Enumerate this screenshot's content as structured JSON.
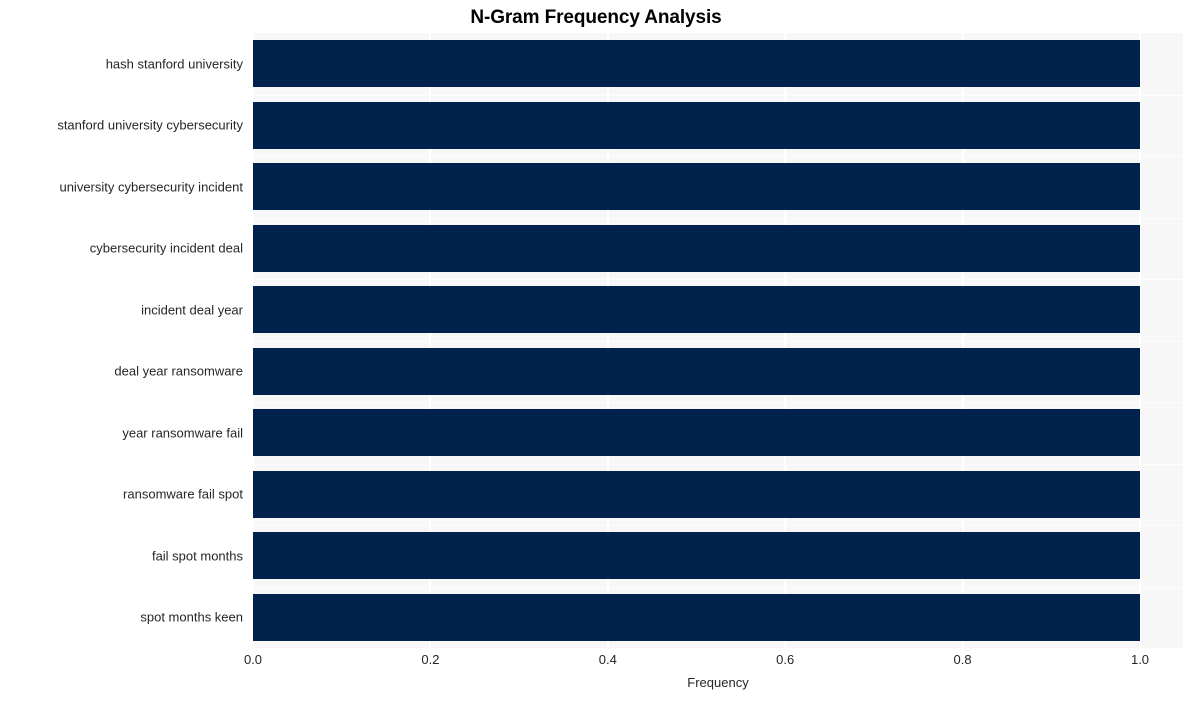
{
  "chart_data": {
    "type": "bar",
    "orientation": "horizontal",
    "title": "N-Gram Frequency Analysis",
    "xlabel": "Frequency",
    "ylabel": "",
    "categories": [
      "hash stanford university",
      "stanford university cybersecurity",
      "university cybersecurity incident",
      "cybersecurity incident deal",
      "incident deal year",
      "deal year ransomware",
      "year ransomware fail",
      "ransomware fail spot",
      "fail spot months",
      "spot months keen"
    ],
    "values": [
      1.0,
      1.0,
      1.0,
      1.0,
      1.0,
      1.0,
      1.0,
      1.0,
      1.0,
      1.0
    ],
    "xlim": [
      0.0,
      1.05
    ],
    "xticks": [
      "0.0",
      "0.2",
      "0.4",
      "0.6",
      "0.8",
      "1.0"
    ],
    "xtick_values": [
      0.0,
      0.2,
      0.4,
      0.6,
      0.8,
      1.0
    ],
    "grid": true,
    "grid_axis": "x",
    "legend": null,
    "bar_color": "#00224d",
    "plot_background": "#f7f7f7",
    "gridline_color": "#ffffff",
    "figure_background": "#ffffff",
    "text_color": "#262626",
    "title_color": "#000000"
  }
}
